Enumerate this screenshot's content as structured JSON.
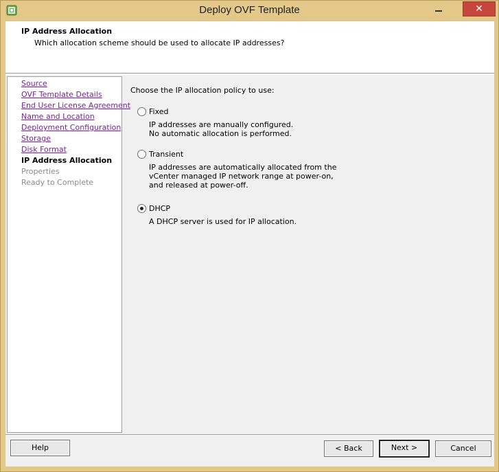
{
  "window": {
    "title": "Deploy OVF Template",
    "close_glyph": "✕",
    "accent": "#e3c88a",
    "close_color": "#c7463b",
    "icon": "vsphere-app-icon"
  },
  "header": {
    "title": "IP Address Allocation",
    "subtitle": "Which allocation scheme should be used to allocate IP addresses?"
  },
  "nav": {
    "link_color": "#7a1fa2",
    "items": [
      {
        "label": "Source",
        "state": "link"
      },
      {
        "label": "OVF Template Details",
        "state": "link"
      },
      {
        "label": "End User License Agreement",
        "state": "link"
      },
      {
        "label": "Name and Location",
        "state": "link"
      },
      {
        "label": "Deployment Configuration",
        "state": "link"
      },
      {
        "label": "Storage",
        "state": "link"
      },
      {
        "label": "Disk Format",
        "state": "link"
      },
      {
        "label": "IP Address Allocation",
        "state": "current"
      },
      {
        "label": "Properties",
        "state": "disabled"
      },
      {
        "label": "Ready to Complete",
        "state": "disabled"
      }
    ]
  },
  "content": {
    "prompt": "Choose the IP allocation policy to use:",
    "options": [
      {
        "label": "Fixed",
        "checked": false,
        "desc": [
          "IP addresses are manually configured.",
          "No automatic allocation is performed."
        ]
      },
      {
        "label": "Transient",
        "checked": false,
        "desc": [
          "IP addresses are automatically allocated from the",
          "vCenter managed IP network range at power-on,",
          "and released at power-off."
        ]
      },
      {
        "label": "DHCP",
        "checked": true,
        "desc": [
          "A DHCP server is used for IP allocation."
        ]
      }
    ]
  },
  "footer": {
    "help": "Help",
    "back": "< Back",
    "next": "Next >",
    "cancel": "Cancel"
  }
}
